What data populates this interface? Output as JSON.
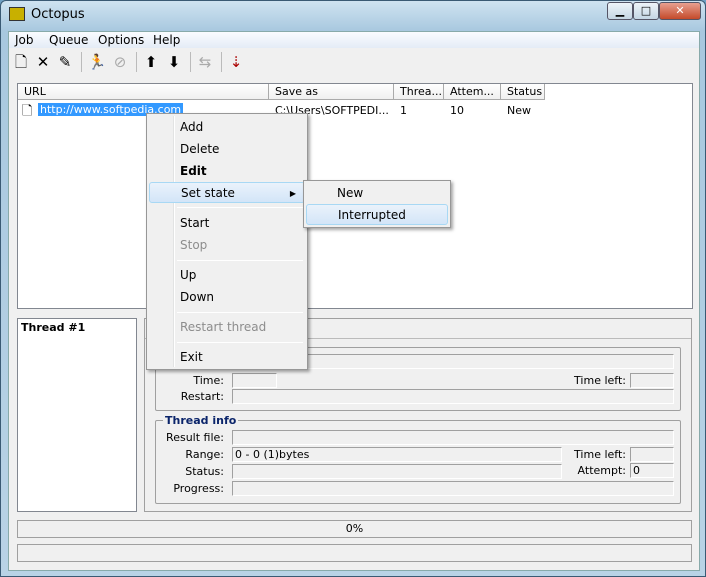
{
  "window": {
    "title": "Octopus",
    "minimize": "▁",
    "maximize": "□",
    "close": "✕"
  },
  "menu": [
    "Job",
    "Queue",
    "Options",
    "Help"
  ],
  "toolbar": [
    {
      "icon": "new-job-icon",
      "glyph": "🗋"
    },
    {
      "icon": "delete-icon",
      "glyph": "✕"
    },
    {
      "icon": "edit-icon",
      "glyph": "✎"
    },
    {
      "icon": "start-runner-icon",
      "glyph": "🏃"
    },
    {
      "icon": "stop-icon",
      "glyph": "⊘"
    },
    {
      "icon": "up-arrow-icon",
      "glyph": "⬆"
    },
    {
      "icon": "down-arrow-icon",
      "glyph": "⬇"
    },
    {
      "icon": "restart-thread-icon",
      "glyph": "⇆"
    },
    {
      "icon": "sort-icon",
      "glyph": "⇣"
    }
  ],
  "list": {
    "columns": [
      "URL",
      "Save as",
      "Threa...",
      "Attem...",
      "Status"
    ],
    "rows": [
      {
        "url": "http://www.softpedia.com",
        "save_as": "C:\\Users\\SOFTPEDI...",
        "threads": "1",
        "attempts": "10",
        "status": "New"
      }
    ]
  },
  "threads": {
    "items": [
      "Thread #1"
    ]
  },
  "job_info": {
    "time_label": "Time:",
    "time_left_label": "Time left:",
    "restart_label": "Restart:"
  },
  "thread_info": {
    "title": "Thread info",
    "result_file_label": "Result file:",
    "range_label": "Range:",
    "range_value": "0 - 0 (1)bytes",
    "status_label": "Status:",
    "progress_label": "Progress:",
    "time_left_label": "Time left:",
    "attempt_label": "Attempt:",
    "attempt_value": "0"
  },
  "status": {
    "progress": "0%"
  },
  "context_menu": {
    "items": [
      "Add",
      "Delete",
      "Edit",
      "Set state",
      "Start",
      "Stop",
      "Up",
      "Down",
      "Restart thread",
      "Exit"
    ],
    "submenu": [
      "New",
      "Interrupted"
    ]
  }
}
